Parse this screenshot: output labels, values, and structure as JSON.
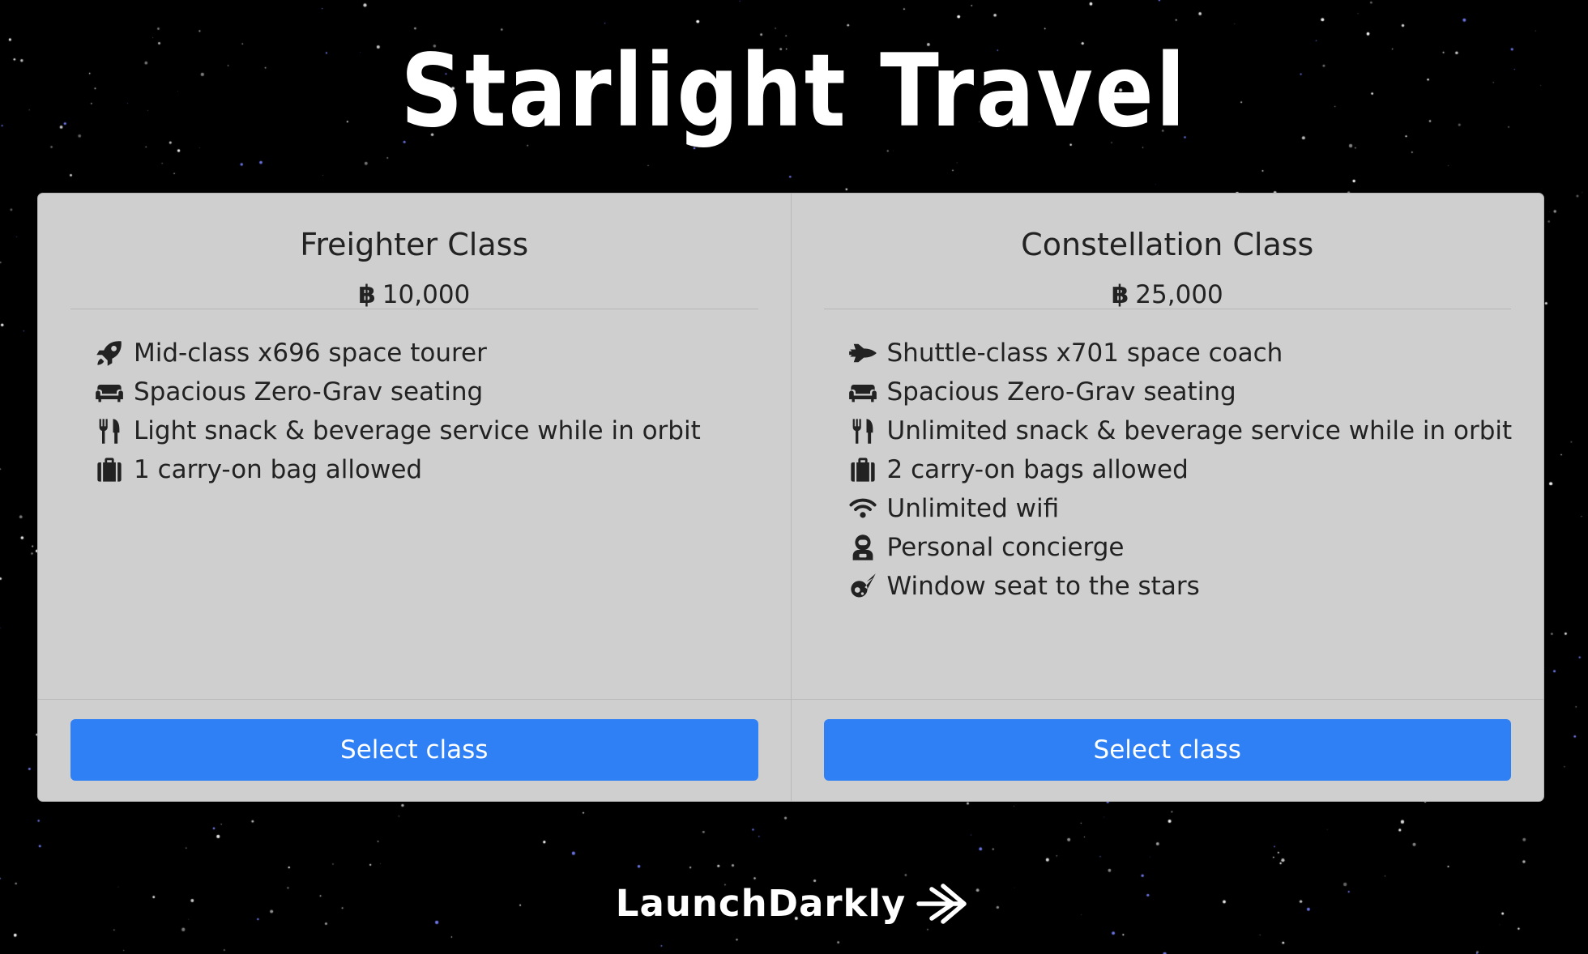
{
  "site": {
    "title": "Starlight Travel"
  },
  "currency_symbol": "฿",
  "classes": [
    {
      "name": "Freighter Class",
      "price": "10,000",
      "features": [
        {
          "icon": "rocket-icon",
          "text": "Mid-class x696 space tourer"
        },
        {
          "icon": "couch-icon",
          "text": "Spacious Zero-Grav seating"
        },
        {
          "icon": "utensils-icon",
          "text": "Light snack & beverage service while in orbit"
        },
        {
          "icon": "suitcase-icon",
          "text": "1 carry-on bag allowed"
        }
      ],
      "button_label": "Select class"
    },
    {
      "name": "Constellation Class",
      "price": "25,000",
      "features": [
        {
          "icon": "space-shuttle-icon",
          "text": "Shuttle-class x701 space coach"
        },
        {
          "icon": "couch-icon",
          "text": "Spacious Zero-Grav seating"
        },
        {
          "icon": "utensils-icon",
          "text": "Unlimited snack & beverage service while in orbit"
        },
        {
          "icon": "suitcase-icon",
          "text": "2 carry-on bags allowed"
        },
        {
          "icon": "wifi-icon",
          "text": "Unlimited wifi"
        },
        {
          "icon": "user-astronaut-icon",
          "text": "Personal concierge"
        },
        {
          "icon": "meteor-icon",
          "text": "Window seat to the stars"
        }
      ],
      "button_label": "Select class"
    }
  ],
  "footer": {
    "brand": "LaunchDarkly",
    "brand_icon": "arrow-icon"
  },
  "colors": {
    "background": "#000000",
    "card": "#cfcfcf",
    "button": "#2f80f5",
    "text": "#222222"
  }
}
